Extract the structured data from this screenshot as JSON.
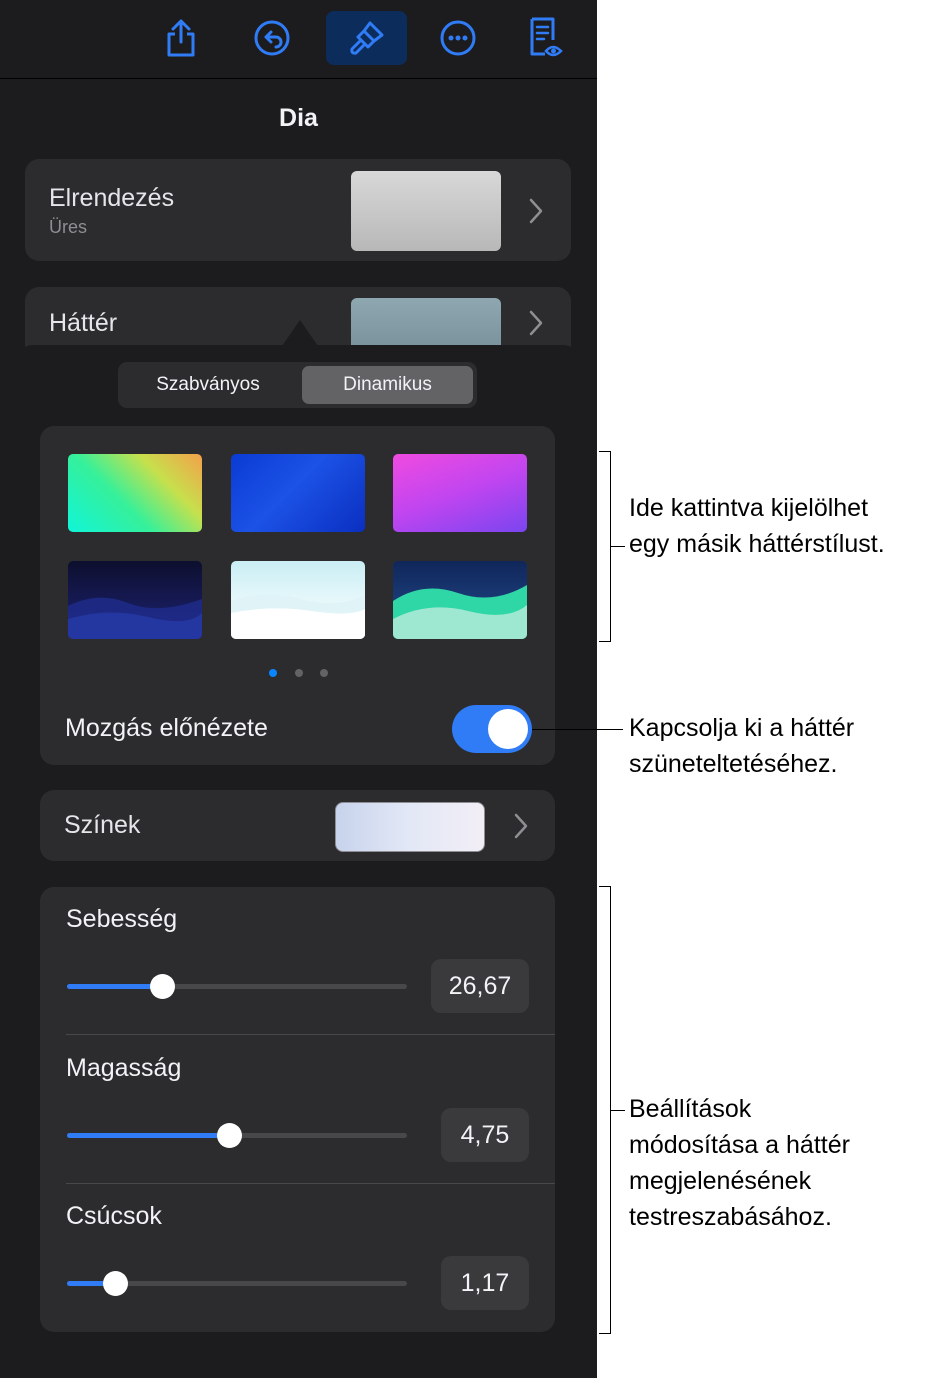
{
  "sheet_title": "Dia",
  "layout_row": {
    "label": "Elrendezés",
    "sublabel": "Üres"
  },
  "background_row": {
    "label": "Háttér"
  },
  "segmented": {
    "standard": "Szabványos",
    "dynamic": "Dinamikus",
    "selected": "Dinamikus"
  },
  "styles_page": {
    "current": 1,
    "total": 3
  },
  "motion_preview": {
    "label": "Mozgás előnézete",
    "on": true
  },
  "colors_row": {
    "label": "Színek"
  },
  "sliders": [
    {
      "label": "Sebesség",
      "value": "26,67",
      "fraction": 0.28
    },
    {
      "label": "Magasság",
      "value": "4,75",
      "fraction": 0.475
    },
    {
      "label": "Csúcsok",
      "value": "1,17",
      "fraction": 0.14
    }
  ],
  "callouts": {
    "styles": [
      "Ide kattintva kijelölhet",
      "egy másik háttérstílust."
    ],
    "toggle": [
      "Kapcsolja ki a háttér",
      "szüneteltetéséhez."
    ],
    "settings": [
      "Beállítások",
      "módosítása a háttér",
      "megjelenésének",
      "testreszabásához."
    ]
  },
  "colors": {
    "panel_bg": "#1c1c1e",
    "card_bg": "#2c2c2e",
    "accent": "#2f7cf6"
  }
}
